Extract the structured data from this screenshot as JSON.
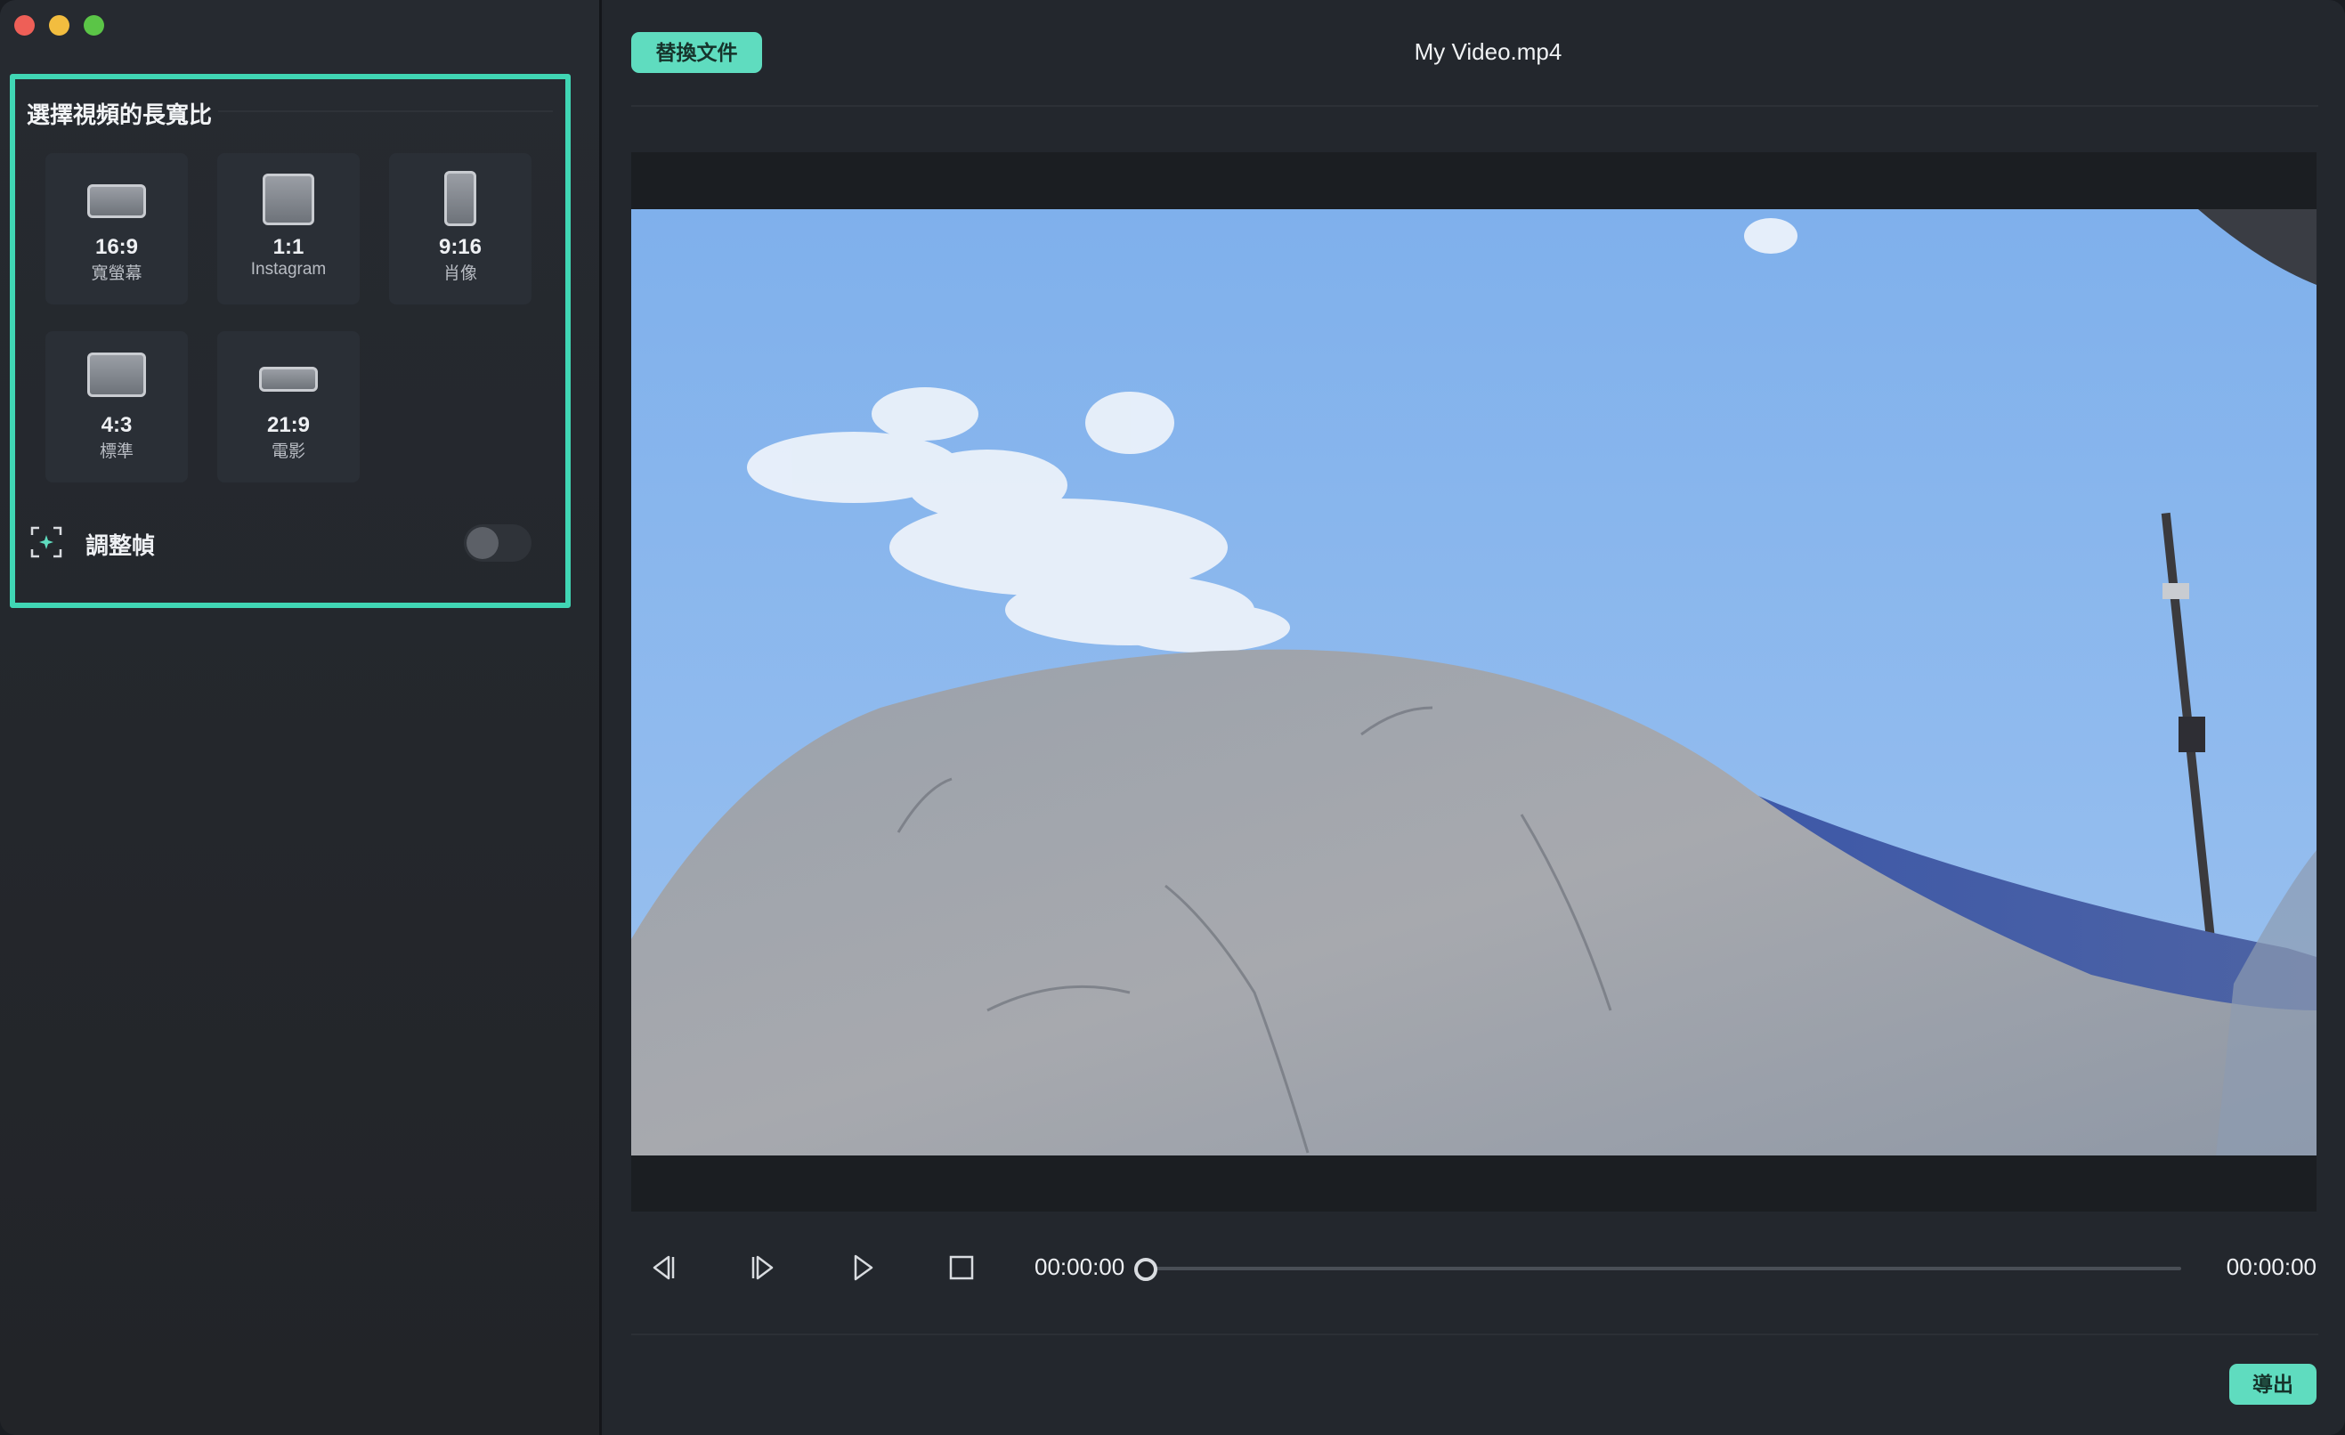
{
  "window": {
    "traffic_lights": [
      "close",
      "minimize",
      "maximize"
    ],
    "colors": {
      "close": "#ee5f57",
      "minimize": "#f2bd3f",
      "maximize": "#5bc547"
    }
  },
  "sidebar": {
    "panel_title": "選擇視頻的長寬比",
    "ratios": [
      {
        "ratio": "16:9",
        "label": "寬螢幕"
      },
      {
        "ratio": "1:1",
        "label": "Instagram"
      },
      {
        "ratio": "9:16",
        "label": "肖像"
      },
      {
        "ratio": "4:3",
        "label": "標準"
      },
      {
        "ratio": "21:9",
        "label": "電影"
      }
    ],
    "adjust_frame": {
      "label": "調整幀",
      "icon": "auto-reframe-icon",
      "enabled": false
    }
  },
  "header": {
    "replace_button": "替換文件",
    "file_name": "My Video.mp4"
  },
  "player": {
    "current_time": "00:00:00",
    "total_time": "00:00:00",
    "progress": 0,
    "buttons": [
      "previous-frame-icon",
      "next-frame-icon",
      "play-icon",
      "stop-icon"
    ]
  },
  "footer": {
    "export_button": "導出"
  },
  "colors": {
    "accent": "#5fdcbf",
    "highlight_border": "#40d6b4",
    "background": "#23272d"
  }
}
